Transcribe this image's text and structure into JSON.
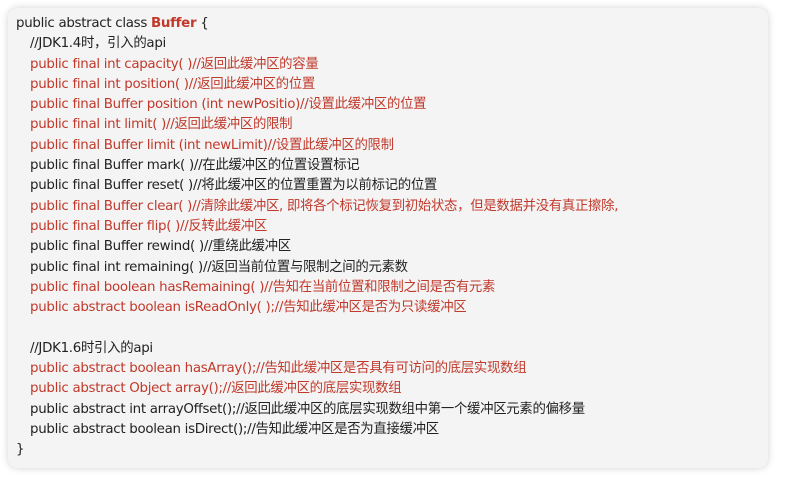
{
  "header": {
    "prefix": "public abstract class ",
    "class_name": "Buffer",
    "brace_open": " {"
  },
  "colors": {
    "red": "#c0392b",
    "black": "#222222"
  },
  "section1": {
    "comment": "//JDK1.4时，引入的api",
    "lines": [
      {
        "text": "public final int capacity( )//返回此缓冲区的容量",
        "color": "red"
      },
      {
        "text": "public final int position( )//返回此缓冲区的位置",
        "color": "red"
      },
      {
        "text": "public final Buffer position (int newPositio)//设置此缓冲区的位置",
        "color": "red"
      },
      {
        "text": "public final int limit( )//返回此缓冲区的限制",
        "color": "red"
      },
      {
        "text": "public final Buffer limit (int newLimit)//设置此缓冲区的限制",
        "color": "red"
      },
      {
        "text": "public final Buffer mark( )//在此缓冲区的位置设置标记",
        "color": "black"
      },
      {
        "text": "public final Buffer reset( )//将此缓冲区的位置重置为以前标记的位置",
        "color": "black"
      },
      {
        "text": "public final Buffer clear( )//清除此缓冲区, 即将各个标记恢复到初始状态，但是数据并没有真正擦除,",
        "color": "red"
      },
      {
        "text": "public final Buffer flip( )//反转此缓冲区",
        "color": "red"
      },
      {
        "text": "public final Buffer rewind( )//重绕此缓冲区",
        "color": "black"
      },
      {
        "text": "public final int remaining( )//返回当前位置与限制之间的元素数",
        "color": "black"
      },
      {
        "text": "public final boolean hasRemaining( )//告知在当前位置和限制之间是否有元素",
        "color": "red"
      },
      {
        "text": "public abstract boolean isReadOnly( );//告知此缓冲区是否为只读缓冲区",
        "color": "red"
      }
    ]
  },
  "section2": {
    "comment": "//JDK1.6时引入的api",
    "lines": [
      {
        "text": "public abstract boolean hasArray();//告知此缓冲区是否具有可访问的底层实现数组",
        "color": "red"
      },
      {
        "text": "public abstract Object array();//返回此缓冲区的底层实现数组",
        "color": "red"
      },
      {
        "text": "public abstract int arrayOffset();//返回此缓冲区的底层实现数组中第一个缓冲区元素的偏移量",
        "color": "black"
      },
      {
        "text": "public abstract boolean isDirect();//告知此缓冲区是否为直接缓冲区",
        "color": "black"
      }
    ]
  },
  "footer": {
    "brace_close": "}"
  }
}
